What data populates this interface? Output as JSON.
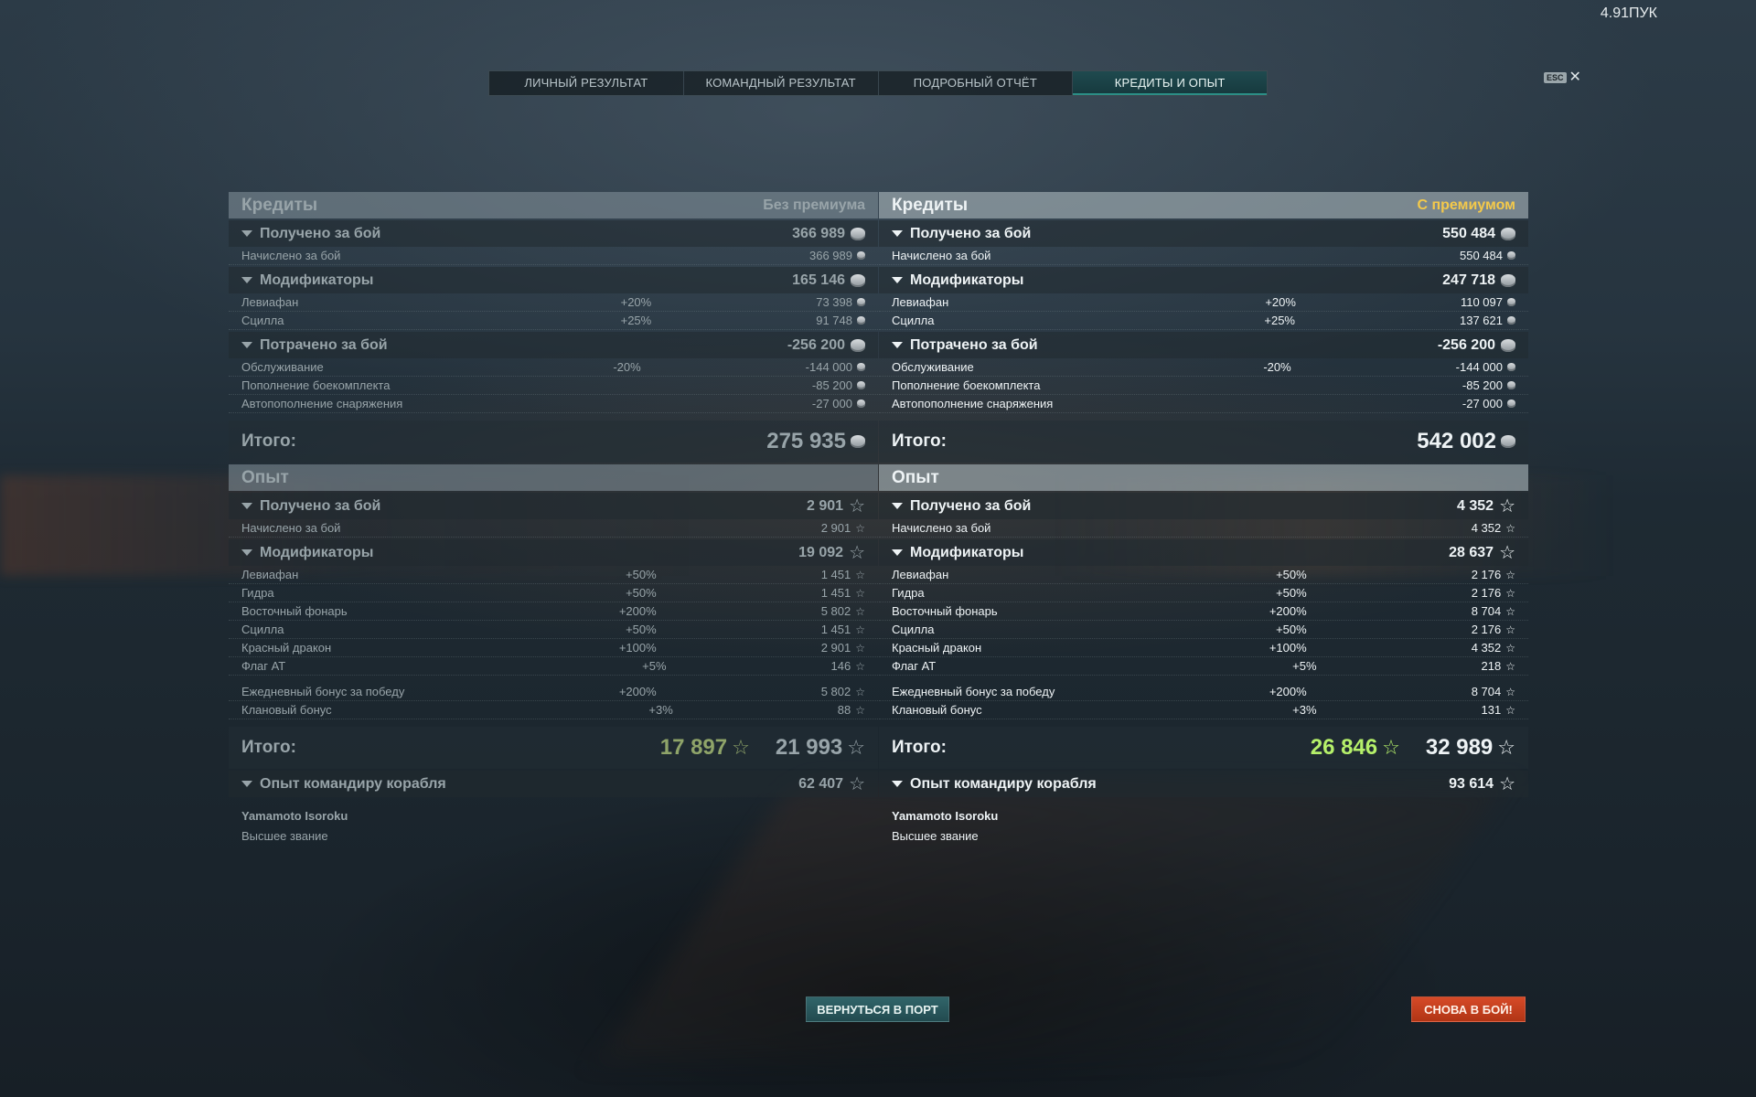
{
  "hud": {
    "fps": "4.91ПУК"
  },
  "tabs": [
    "ЛИЧНЫЙ РЕЗУЛЬТАТ",
    "КОМАНДНЫЙ РЕЗУЛЬТАТ",
    "ПОДРОБНЫЙ ОТЧЁТ",
    "КРЕДИТЫ И ОПЫТ"
  ],
  "active_tab": "КРЕДИТЫ И ОПЫТ",
  "esc": {
    "key": "ESC",
    "close": "✕"
  },
  "icons": {
    "credit": "credit-coin-icon",
    "xp": "star-icon",
    "collapse": "triangle-down-icon"
  },
  "colors": {
    "premium": "#f4c94a",
    "xp_green": "#b5f06a",
    "accent_tab": "#2c8e86",
    "again_button": "#c9401e",
    "port_button": "#2a5a5e"
  },
  "left": {
    "credits_title": "Кредиты",
    "credits_mode": "Без премиума",
    "received": {
      "label": "Получено за бой",
      "value": "366 989"
    },
    "received_rows": [
      {
        "name": "Начислено за бой",
        "pct": "",
        "value": "366 989"
      }
    ],
    "modifiers": {
      "label": "Модификаторы",
      "value": "165 146"
    },
    "modifier_rows": [
      {
        "name": "Левиафан",
        "pct": "+20%",
        "value": "73 398"
      },
      {
        "name": "Сцилла",
        "pct": "+25%",
        "value": "91 748"
      }
    ],
    "spent": {
      "label": "Потрачено за бой",
      "value": "-256 200"
    },
    "spent_rows": [
      {
        "name": "Обслуживание",
        "pct": "-20%",
        "value": "-144 000"
      },
      {
        "name": "Пополнение боекомплекта",
        "pct": "",
        "value": "-85 200"
      },
      {
        "name": "Автопополнение снаряжения",
        "pct": "",
        "value": "-27 000"
      }
    ],
    "credits_total": {
      "label": "Итого:",
      "value": "275 935"
    },
    "xp_title": "Опыт",
    "xp_received": {
      "label": "Получено за бой",
      "value": "2 901"
    },
    "xp_received_rows": [
      {
        "name": "Начислено за бой",
        "pct": "",
        "value": "2 901"
      }
    ],
    "xp_modifiers": {
      "label": "Модификаторы",
      "value": "19 092"
    },
    "xp_modifier_rows": [
      {
        "name": "Левиафан",
        "pct": "+50%",
        "value": "1 451"
      },
      {
        "name": "Гидра",
        "pct": "+50%",
        "value": "1 451"
      },
      {
        "name": "Восточный фонарь",
        "pct": "+200%",
        "value": "5 802"
      },
      {
        "name": "Сцилла",
        "pct": "+50%",
        "value": "1 451"
      },
      {
        "name": "Красный дракон",
        "pct": "+100%",
        "value": "2 901"
      },
      {
        "name": "Флаг АТ",
        "pct": "+5%",
        "value": "146"
      }
    ],
    "xp_bonus_rows": [
      {
        "name": "Ежедневный бонус за победу",
        "pct": "+200%",
        "value": "5 802"
      },
      {
        "name": "Клановый бонус",
        "pct": "+3%",
        "value": "88"
      }
    ],
    "xp_total": {
      "label": "Итого:",
      "value_ship": "17 897",
      "value_total": "21 993"
    },
    "commander": {
      "label": "Опыт командиру корабля",
      "value": "62 407",
      "name": "Yamamoto Isoroku",
      "rank": "Высшее звание"
    }
  },
  "right": {
    "credits_title": "Кредиты",
    "credits_mode": "С премиумом",
    "received": {
      "label": "Получено за бой",
      "value": "550 484"
    },
    "received_rows": [
      {
        "name": "Начислено за бой",
        "pct": "",
        "value": "550 484"
      }
    ],
    "modifiers": {
      "label": "Модификаторы",
      "value": "247 718"
    },
    "modifier_rows": [
      {
        "name": "Левиафан",
        "pct": "+20%",
        "value": "110 097"
      },
      {
        "name": "Сцилла",
        "pct": "+25%",
        "value": "137 621"
      }
    ],
    "spent": {
      "label": "Потрачено за бой",
      "value": "-256 200"
    },
    "spent_rows": [
      {
        "name": "Обслуживание",
        "pct": "-20%",
        "value": "-144 000"
      },
      {
        "name": "Пополнение боекомплекта",
        "pct": "",
        "value": "-85 200"
      },
      {
        "name": "Автопополнение снаряжения",
        "pct": "",
        "value": "-27 000"
      }
    ],
    "credits_total": {
      "label": "Итого:",
      "value": "542 002"
    },
    "xp_title": "Опыт",
    "xp_received": {
      "label": "Получено за бой",
      "value": "4 352"
    },
    "xp_received_rows": [
      {
        "name": "Начислено за бой",
        "pct": "",
        "value": "4 352"
      }
    ],
    "xp_modifiers": {
      "label": "Модификаторы",
      "value": "28 637"
    },
    "xp_modifier_rows": [
      {
        "name": "Левиафан",
        "pct": "+50%",
        "value": "2 176"
      },
      {
        "name": "Гидра",
        "pct": "+50%",
        "value": "2 176"
      },
      {
        "name": "Восточный фонарь",
        "pct": "+200%",
        "value": "8 704"
      },
      {
        "name": "Сцилла",
        "pct": "+50%",
        "value": "2 176"
      },
      {
        "name": "Красный дракон",
        "pct": "+100%",
        "value": "4 352"
      },
      {
        "name": "Флаг АТ",
        "pct": "+5%",
        "value": "218"
      }
    ],
    "xp_bonus_rows": [
      {
        "name": "Ежедневный бонус за победу",
        "pct": "+200%",
        "value": "8 704"
      },
      {
        "name": "Клановый бонус",
        "pct": "+3%",
        "value": "131"
      }
    ],
    "xp_total": {
      "label": "Итого:",
      "value_ship": "26 846",
      "value_total": "32 989"
    },
    "commander": {
      "label": "Опыт командиру корабля",
      "value": "93 614",
      "name": "Yamamoto Isoroku",
      "rank": "Высшее звание"
    }
  },
  "buttons": {
    "return_port": "ВЕРНУТЬСЯ В ПОРТ",
    "battle_again": "СНОВА В БОЙ!"
  }
}
